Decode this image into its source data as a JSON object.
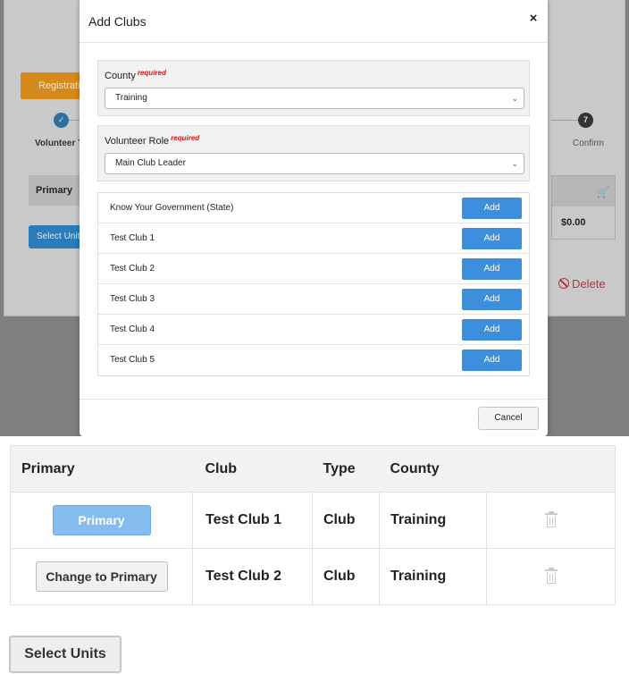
{
  "background_page": {
    "registration_tab": "Registration",
    "step1_number": "✓",
    "step1_label": "Volunteer Type",
    "step7_number": "7",
    "step7_label": "Confirm",
    "table_header_primary": "Primary",
    "select_units_label": "Select Units",
    "cart_total": "$0.00",
    "delete_label": "Delete"
  },
  "modal": {
    "title": "Add Clubs",
    "close_glyph": "×",
    "county": {
      "label": "County",
      "required_tag": "required",
      "value": "Training"
    },
    "volunteer_role": {
      "label": "Volunteer Role",
      "required_tag": "required",
      "value": "Main Club Leader"
    },
    "clubs": [
      {
        "name": "Know Your Government (State)",
        "button": "Add"
      },
      {
        "name": "Test Club 1",
        "button": "Add"
      },
      {
        "name": "Test Club 2",
        "button": "Add"
      },
      {
        "name": "Test Club 3",
        "button": "Add"
      },
      {
        "name": "Test Club 4",
        "button": "Add"
      },
      {
        "name": "Test Club 5",
        "button": "Add"
      }
    ],
    "cancel_label": "Cancel"
  },
  "units_table": {
    "headers": {
      "primary": "Primary",
      "club": "Club",
      "type": "Type",
      "county": "County"
    },
    "rows": [
      {
        "primary_button": "Primary",
        "club": "Test Club 1",
        "type": "Club",
        "county": "Training"
      },
      {
        "primary_button": "Change to Primary",
        "club": "Test Club 2",
        "type": "Club",
        "county": "Training"
      }
    ]
  },
  "select_units_button": "Select Units",
  "colors": {
    "accent_blue": "#3c8fdc",
    "primary_active": "#85bdf0",
    "required_red": "#e2141c",
    "registration_orange": "#d68a1b",
    "delete_red": "#b8323a"
  }
}
